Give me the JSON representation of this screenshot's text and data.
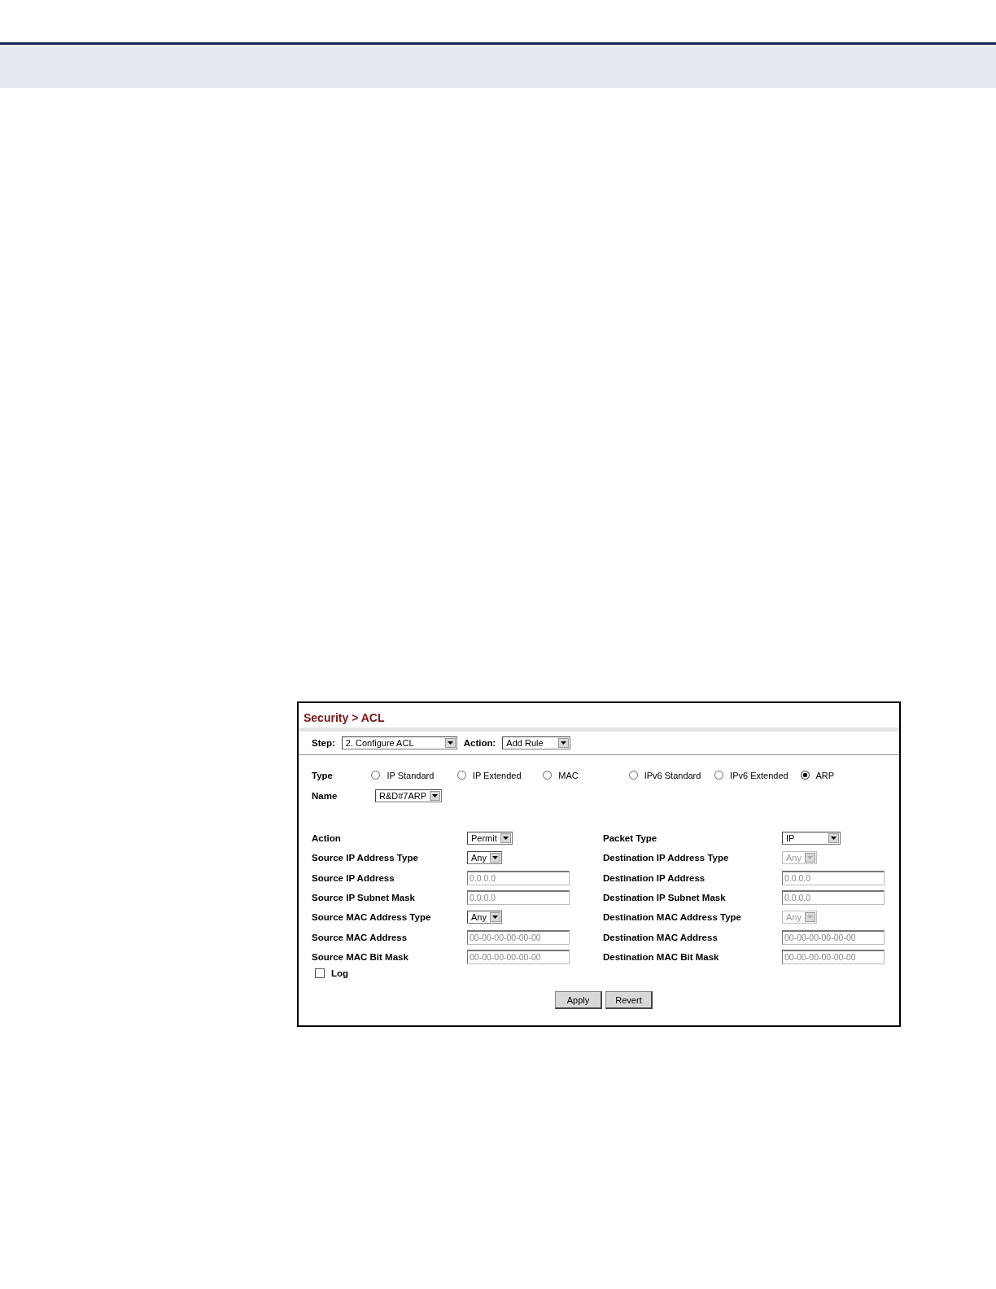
{
  "title": "Security > ACL",
  "toolbar": [
    {
      "label": "Step:",
      "value": "2. Configure ACL"
    },
    {
      "label": "Action:",
      "value": "Add Rule"
    }
  ],
  "type": {
    "label": "Type",
    "options": [
      {
        "label": "IP Standard",
        "selected": false
      },
      {
        "label": "IP Extended",
        "selected": false
      },
      {
        "label": "MAC",
        "selected": false
      },
      {
        "label": "IPv6 Standard",
        "selected": false
      },
      {
        "label": "IPv6 Extended",
        "selected": false
      },
      {
        "label": "ARP",
        "selected": true
      }
    ]
  },
  "name": {
    "label": "Name",
    "value": "R&D#7ARP"
  },
  "left_fields": [
    {
      "label": "Action",
      "kind": "select",
      "value": "Permit",
      "disabled": false
    },
    {
      "label": "Source IP Address Type",
      "kind": "select",
      "value": "Any",
      "disabled": false
    },
    {
      "label": "Source IP Address",
      "kind": "text",
      "value": "0.0.0.0",
      "disabled": true
    },
    {
      "label": "Source IP Subnet Mask",
      "kind": "text",
      "value": "0.0.0.0",
      "disabled": true
    },
    {
      "label": "Source MAC Address Type",
      "kind": "select",
      "value": "Any",
      "disabled": false
    },
    {
      "label": "Source MAC Address",
      "kind": "text",
      "value": "00-00-00-00-00-00",
      "disabled": true
    },
    {
      "label": "Source MAC Bit Mask",
      "kind": "text",
      "value": "00-00-00-00-00-00",
      "disabled": true
    }
  ],
  "right_fields": [
    {
      "label": "Packet Type",
      "kind": "select",
      "value": "IP",
      "disabled": false
    },
    {
      "label": "Destination IP Address Type",
      "kind": "select",
      "value": "Any",
      "disabled": true
    },
    {
      "label": "Destination IP Address",
      "kind": "text",
      "value": "0.0.0.0",
      "disabled": true
    },
    {
      "label": "Destination IP Subnet Mask",
      "kind": "text",
      "value": "0.0.0.0",
      "disabled": true
    },
    {
      "label": "Destination MAC Address Type",
      "kind": "select",
      "value": "Any",
      "disabled": true
    },
    {
      "label": "Destination MAC Address",
      "kind": "text",
      "value": "00-00-00-00-00-00",
      "disabled": true
    },
    {
      "label": "Destination MAC Bit Mask",
      "kind": "text",
      "value": "00-00-00-00-00-00",
      "disabled": true
    }
  ],
  "log": {
    "label": "Log",
    "checked": false
  },
  "buttons": [
    "Apply",
    "Revert"
  ]
}
